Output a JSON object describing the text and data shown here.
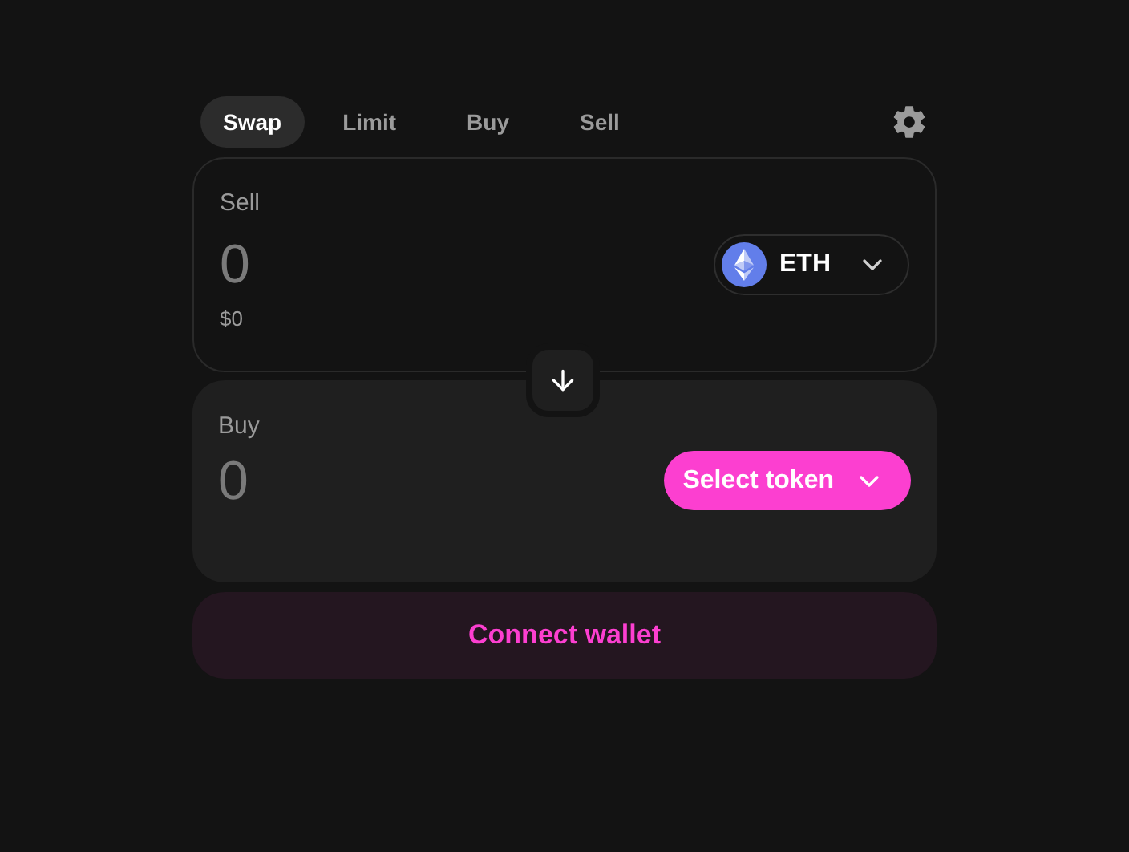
{
  "tabs": [
    {
      "label": "Swap",
      "selected": true
    },
    {
      "label": "Limit",
      "selected": false
    },
    {
      "label": "Buy",
      "selected": false
    },
    {
      "label": "Sell",
      "selected": false
    }
  ],
  "sell": {
    "label": "Sell",
    "amount": "0",
    "usd": "$0",
    "token": {
      "kind": "token",
      "symbol": "ETH"
    }
  },
  "buy": {
    "label": "Buy",
    "amount": "0",
    "token": {
      "kind": "select",
      "label": "Select token"
    }
  },
  "connect_button": "Connect wallet"
}
